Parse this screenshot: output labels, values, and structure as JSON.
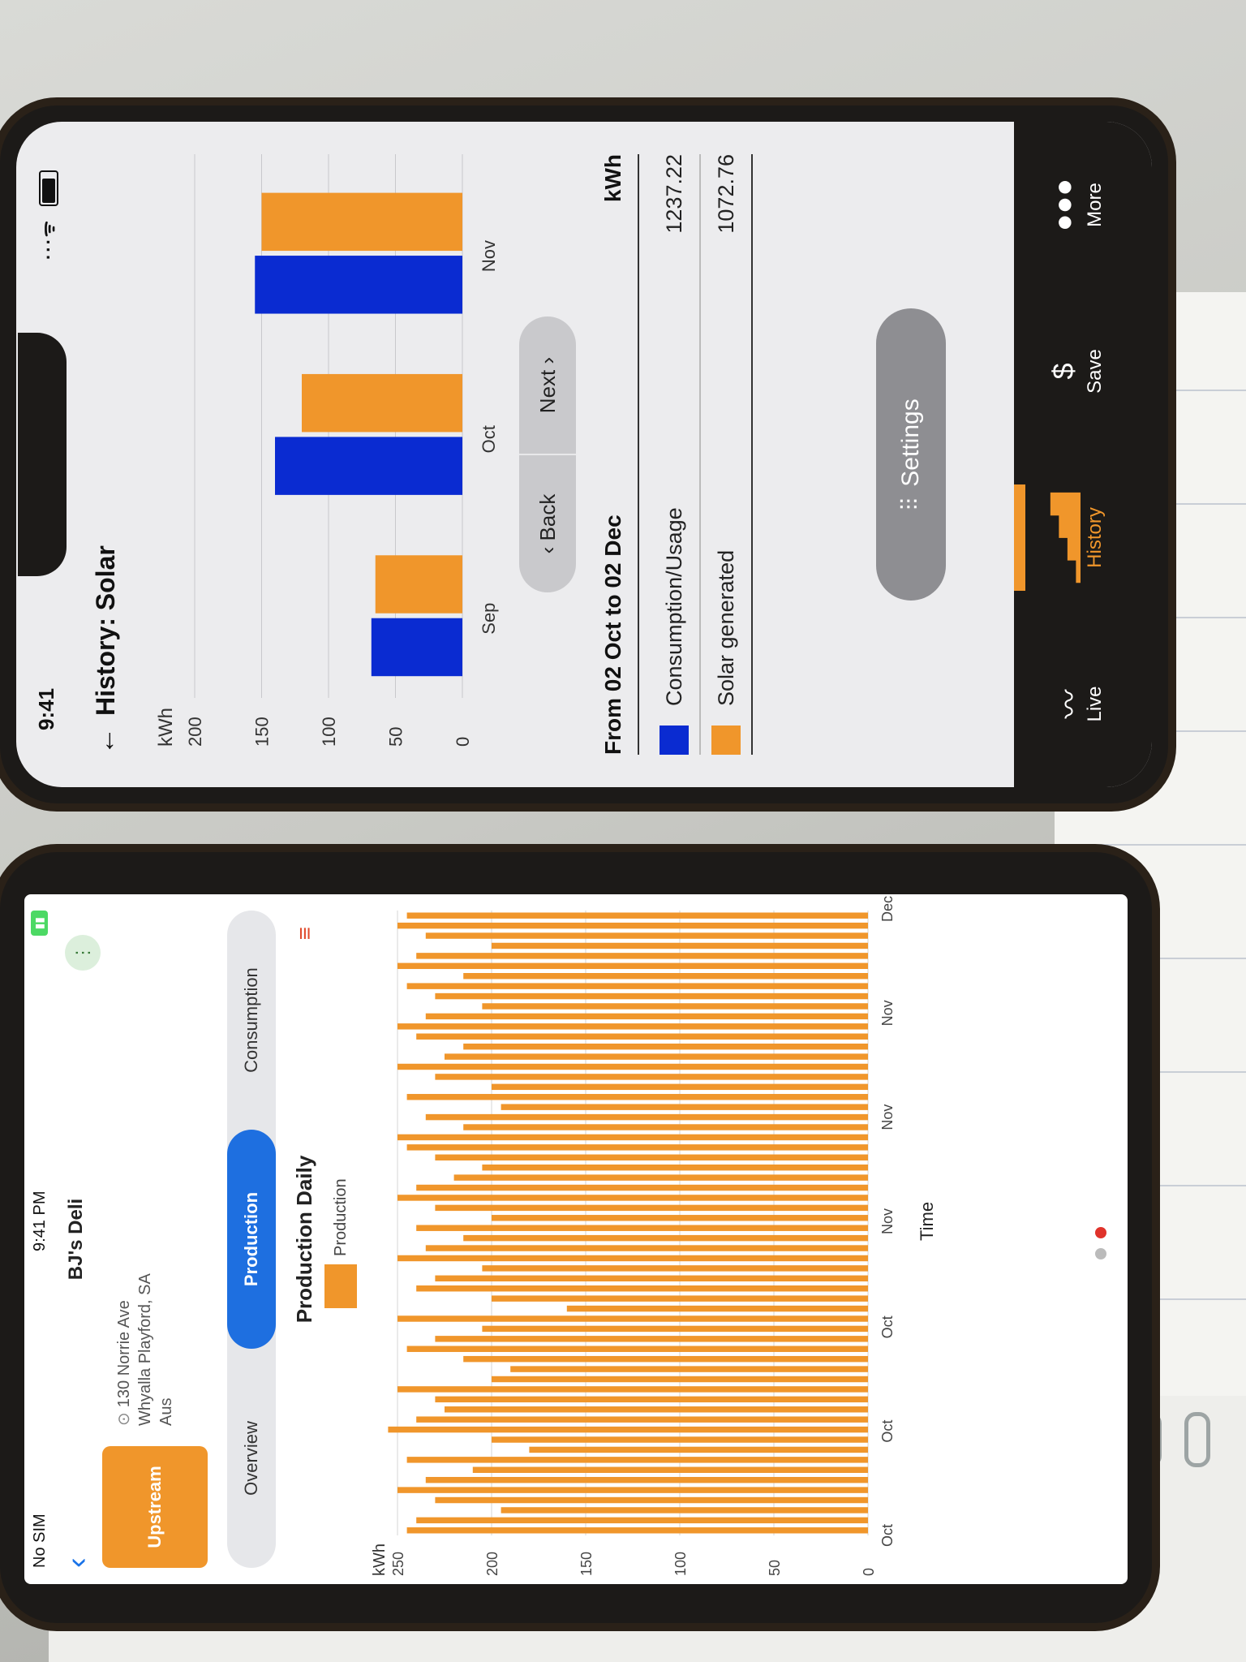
{
  "phone1": {
    "status_time": "9:41",
    "header": {
      "title": "History: Solar"
    },
    "chart_data": {
      "type": "bar",
      "ylabel": "kWh",
      "ylim": [
        0,
        200
      ],
      "yticks": [
        "0",
        "50",
        "100",
        "150",
        "200"
      ],
      "categories": [
        "Sep",
        "Oct",
        "Nov"
      ],
      "series": [
        {
          "name": "Consumption/Usage",
          "color": "#0a2bd1",
          "values": [
            68,
            140,
            155
          ]
        },
        {
          "name": "Solar generated",
          "color": "#f0962b",
          "values": [
            65,
            120,
            150
          ]
        }
      ],
      "grid": true
    },
    "nav": {
      "back_label": "Back",
      "next_label": "Next"
    },
    "range": {
      "label": "From 02 Oct to 02 Dec",
      "unit": "kWh"
    },
    "legend": [
      {
        "label": "Consumption/Usage",
        "value": "1237.22",
        "color": "#0a2bd1"
      },
      {
        "label": "Solar generated",
        "value": "1072.76",
        "color": "#f0962b"
      }
    ],
    "settings_label": "Settings",
    "tabbar": [
      {
        "label": "Live",
        "icon": "pulse-icon"
      },
      {
        "label": "History",
        "icon": "bar-chart-icon",
        "active": true
      },
      {
        "label": "Save",
        "icon": "bill-icon"
      },
      {
        "label": "More",
        "icon": "ellipsis-icon"
      }
    ]
  },
  "phone2": {
    "status": {
      "carrier": "No SIM",
      "time": "9:41 PM"
    },
    "header": {
      "store": "BJ's Deli"
    },
    "brand": "Upstream",
    "address": [
      "130 Norrie Ave",
      "Whyalla Playford, SA",
      "Aus"
    ],
    "tabs": [
      {
        "label": "Overview"
      },
      {
        "label": "Production",
        "active": true
      },
      {
        "label": "Consumption"
      }
    ],
    "chart_data": {
      "type": "bar",
      "title": "Production Daily",
      "legend": "Production",
      "ylabel": "kWh",
      "xlabel": "Time",
      "ylim": [
        0,
        250
      ],
      "yticks": [
        "0",
        "50",
        "100",
        "150",
        "200",
        "250"
      ],
      "xticks": [
        "Oct",
        "Oct",
        "Oct",
        "Nov",
        "Nov",
        "Nov",
        "Dec"
      ],
      "color": "#f0962b",
      "values": [
        245,
        240,
        195,
        230,
        250,
        235,
        210,
        245,
        180,
        200,
        255,
        240,
        225,
        230,
        250,
        200,
        190,
        215,
        245,
        230,
        205,
        250,
        160,
        200,
        240,
        230,
        205,
        250,
        235,
        215,
        240,
        200,
        230,
        250,
        240,
        220,
        205,
        230,
        245,
        250,
        215,
        235,
        195,
        245,
        200,
        230,
        250,
        225,
        215,
        240,
        250,
        235,
        205,
        230,
        245,
        215,
        250,
        240,
        200,
        235,
        250,
        245
      ]
    }
  }
}
